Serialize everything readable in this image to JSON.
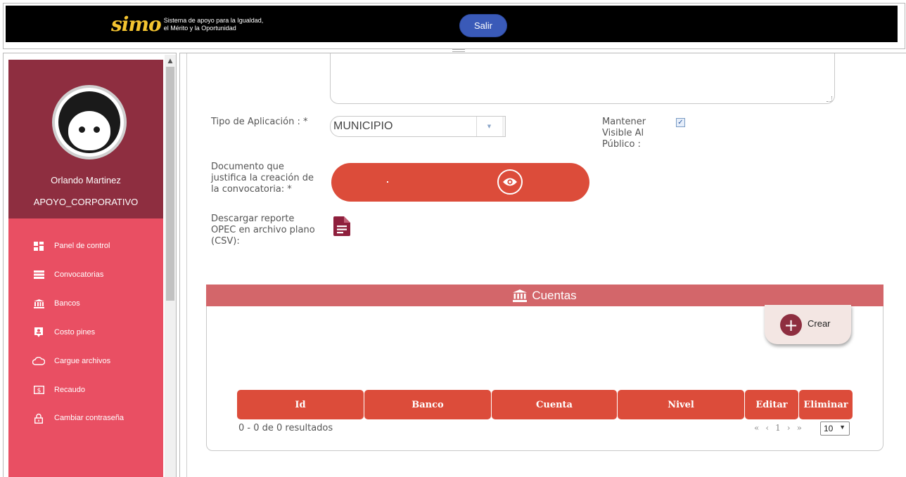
{
  "header": {
    "logo_mark": "simo",
    "logo_line1": "Sistema de apoyo para la Igualdad,",
    "logo_line2": "el Mérito y la Oportunidad",
    "logout_label": "Salir"
  },
  "sidebar": {
    "user_name": "Orlando Martinez",
    "user_role": "APOYO_CORPORATIVO",
    "items": [
      {
        "label": "Panel de control",
        "icon": "dashboard-icon"
      },
      {
        "label": "Convocatorias",
        "icon": "list-icon"
      },
      {
        "label": "Bancos",
        "icon": "bank-icon"
      },
      {
        "label": "Costo pines",
        "icon": "badge-icon"
      },
      {
        "label": "Cargue archivos",
        "icon": "cloud-icon"
      },
      {
        "label": "Recaudo",
        "icon": "money-icon"
      },
      {
        "label": "Cambiar contraseña",
        "icon": "lock-icon"
      }
    ]
  },
  "form": {
    "tipo_aplicacion_label": "Tipo de Aplicación : *",
    "tipo_aplicacion_value": "MUNICIPIO",
    "mantener_visible_label_1": "Mantener",
    "mantener_visible_label_2": "Visible Al",
    "mantener_visible_label_3": "Público :",
    "mantener_visible_checked": true,
    "documento_label_1": "Documento que",
    "documento_label_2": "justifica la creación de",
    "documento_label_3": "la convocatoria: *",
    "descargar_label_1": "Descargar reporte",
    "descargar_label_2": "OPEC en archivo plano",
    "descargar_label_3": "(CSV):"
  },
  "cuentas": {
    "title": "Cuentas",
    "create_label": "Crear",
    "columns": [
      "Id",
      "Banco",
      "Cuenta",
      "Nivel",
      "Editar",
      "Eliminar"
    ],
    "rows": [],
    "results_text": "0 - 0 de 0 resultados",
    "current_page": "1",
    "page_size": "10"
  },
  "colors": {
    "header_bg": "#000000",
    "logout_bg": "#3a5ab8",
    "sidebar_top": "#8e2e40",
    "sidebar_menu": "#e94f63",
    "accent_button": "#dc4c3a",
    "panel_header": "#d3666a"
  }
}
